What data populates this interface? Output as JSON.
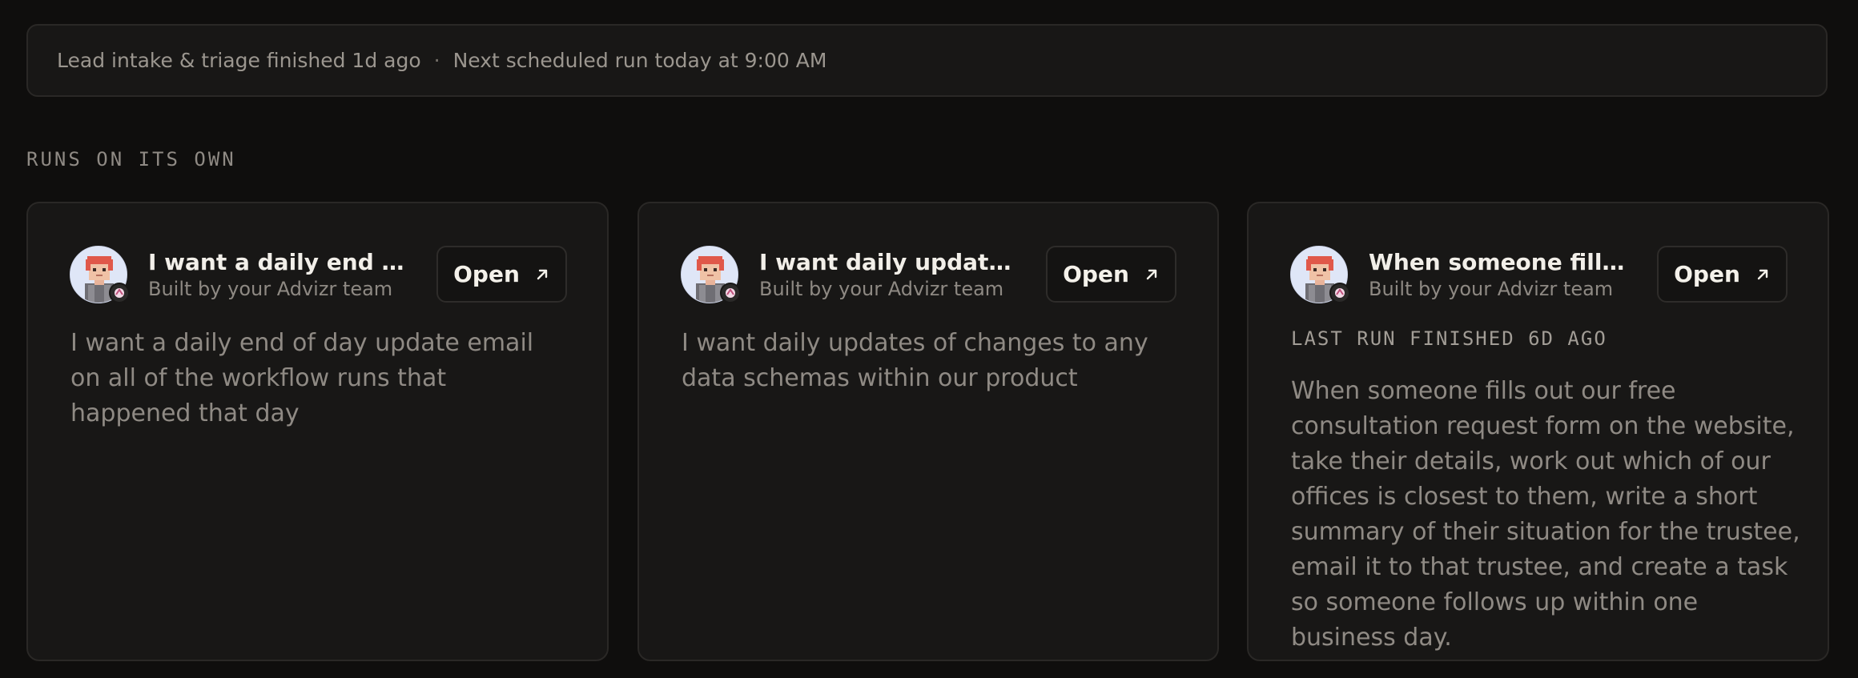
{
  "status": {
    "finished_text": "Lead intake & triage finished 1d ago",
    "separator": "·",
    "next_run_text": "Next scheduled run today at 9:00 AM"
  },
  "section": {
    "label": "RUNS ON ITS OWN"
  },
  "cards": [
    {
      "title": "I want a daily end of day update email on all of the workflow runs that happened that day",
      "title_visible": "I want a daily end of da...",
      "subtitle": "Built by your Advizr team",
      "open_label": "Open",
      "description": "I want a daily end of day update email on all of the workflow runs that happened that day"
    },
    {
      "title": "I want daily updates of changes to any data schemas within our product",
      "title_visible": "I want daily updates of c...",
      "subtitle": "Built by your Advizr team",
      "open_label": "Open",
      "description": "I want daily updates of changes to any data schemas within our product"
    },
    {
      "title": "When someone fills out our free consultation request form on the website",
      "title_visible": "When someone fills out ...",
      "subtitle": "Built by your Advizr team",
      "open_label": "Open",
      "last_run": "LAST RUN FINISHED 6D AGO",
      "description": "When someone fills out our free consultation request form on the website, take their details, work out which of our offices is closest to them, write a short summary of their situation for the trustee, email it to that trustee, and create a task so someone follows up within one business day."
    }
  ],
  "colors": {
    "background": "#0f0e0d",
    "card": "#181716",
    "border": "#2a2826",
    "text_primary": "#f2efe9",
    "text_muted": "#8f8a84"
  },
  "icons": {
    "avatar": "pixel-avatar-icon",
    "open": "arrow-up-right-icon"
  }
}
